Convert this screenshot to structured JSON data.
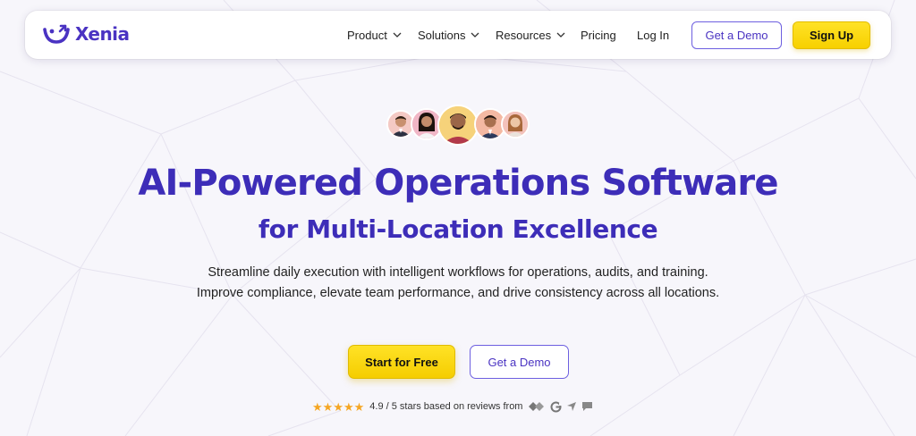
{
  "brand": {
    "name": "Xenia",
    "color": "#4a33c2",
    "accent": "#f7d000"
  },
  "nav": {
    "items": [
      {
        "label": "Product",
        "has_dropdown": true
      },
      {
        "label": "Solutions",
        "has_dropdown": true
      },
      {
        "label": "Resources",
        "has_dropdown": true
      },
      {
        "label": "Pricing",
        "has_dropdown": false
      },
      {
        "label": "Log In",
        "has_dropdown": false
      }
    ],
    "demo_label": "Get a Demo",
    "signup_label": "Sign Up"
  },
  "hero": {
    "avatars": [
      "avatar-person",
      "avatar-person",
      "avatar-person",
      "avatar-person",
      "avatar-person"
    ],
    "title": "AI-Powered Operations Software",
    "subtitle": "for Multi-Location Excellence",
    "description": "Streamline daily execution with intelligent workflows for operations, audits, and training. Improve compliance, elevate team performance, and drive consistency across all locations.",
    "primary_cta": "Start for Free",
    "secondary_cta": "Get a Demo"
  },
  "rating": {
    "stars": 5,
    "text": "4.9 / 5 stars based on reviews from",
    "review_sources": [
      "capterra-icon",
      "g2-icon",
      "getapp-icon",
      "software-advice-icon"
    ]
  }
}
